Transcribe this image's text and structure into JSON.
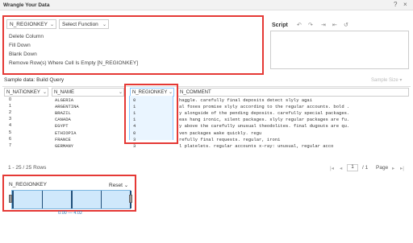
{
  "window": {
    "title": "Wrangle Your Data",
    "help_icon": "?",
    "close_icon": "×"
  },
  "function_panel": {
    "column_select": "N_REGIONKEY",
    "function_select": "Select Function",
    "items": [
      {
        "label": "Delete Column"
      },
      {
        "label": "Fill Down"
      },
      {
        "label": "Blank Down"
      },
      {
        "label": "Remove Row(s) Where Cell Is Empty [N_REGIONKEY]"
      }
    ]
  },
  "script": {
    "label": "Script",
    "icons": [
      "undo-icon",
      "redo-icon",
      "import-icon",
      "export-icon",
      "reset-icon"
    ],
    "icon_glyphs": [
      "↶",
      "↷",
      "⇥",
      "⇤",
      "↺"
    ]
  },
  "sample": {
    "label": "Sample data: Build Query",
    "size_label": "Sample Size ▾"
  },
  "grid": {
    "columns": [
      "N_NATIONKEY",
      "N_NAME",
      "N_REGIONKEY",
      "N_COMMENT"
    ],
    "rows": [
      {
        "nationkey": "0",
        "name": "ALGERIA",
        "regionkey": "0",
        "comment": "haggle. carefully final deposits detect slyly agai"
      },
      {
        "nationkey": "1",
        "name": "ARGENTINA",
        "regionkey": "1",
        "comment": "al foxes promise slyly according to the regular accounts. bold ."
      },
      {
        "nationkey": "2",
        "name": "BRAZIL",
        "regionkey": "1",
        "comment": "y alongside of the pending deposits. carefully special packages."
      },
      {
        "nationkey": "3",
        "name": "CANADA",
        "regionkey": "1",
        "comment": "eas hang ironic, silent packages. slyly regular packages are fu."
      },
      {
        "nationkey": "4",
        "name": "EGYPT",
        "regionkey": "4",
        "comment": "y above the carefully unusual theodolites. final dugouts are qu."
      },
      {
        "nationkey": "5",
        "name": "ETHIOPIA",
        "regionkey": "0",
        "comment": "ven packages wake quickly. regu"
      },
      {
        "nationkey": "6",
        "name": "FRANCE",
        "regionkey": "3",
        "comment": "refully final requests. regular, ironi"
      },
      {
        "nationkey": "7",
        "name": "GERMANY",
        "regionkey": "3",
        "comment": "l platelets. regular accounts x-ray: unusual, regular acco"
      }
    ]
  },
  "pager": {
    "rows_label": "1 - 25 / 25 Rows",
    "current_page": "1",
    "total_pages": "/ 1",
    "page_label": "Page",
    "first": "|◂",
    "prev": "◂",
    "next": "▸",
    "last": "▸|"
  },
  "histogram": {
    "title": "N_REGIONKEY",
    "reset_label": "Reset",
    "range_label": "0.00 — 4.02",
    "bar_positions": [
      0.0,
      0.25,
      0.5,
      0.75,
      1.0
    ]
  },
  "colors": {
    "highlight": "#e53935",
    "accent": "#7bb6e0",
    "bar": "#1f4e79"
  }
}
